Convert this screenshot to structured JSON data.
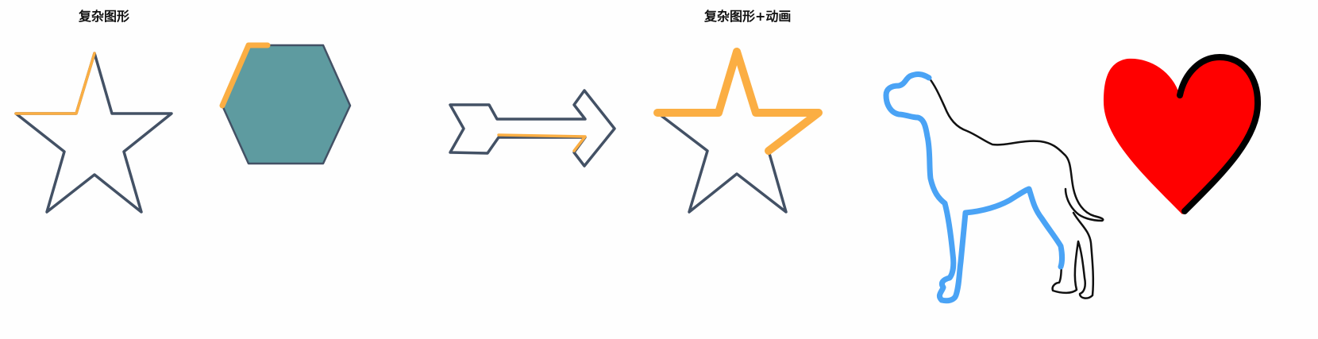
{
  "sections": [
    {
      "title": "复杂图形"
    },
    {
      "title": "复杂图形+动画"
    }
  ],
  "colors": {
    "outline": "#435165",
    "highlight": "#fbae43",
    "hexagon_fill": "#5e9ba0",
    "dog_trace": "#4aa3f5",
    "dog_outline": "#111111",
    "heart_fill": "#ff0000",
    "heart_outline": "#000000"
  },
  "shapes": [
    {
      "name": "star-outline",
      "icon": "star-icon"
    },
    {
      "name": "hexagon",
      "icon": "hexagon-icon"
    },
    {
      "name": "arrow-outline",
      "icon": "arrow-right-icon"
    },
    {
      "name": "star-animated",
      "icon": "star-icon"
    },
    {
      "name": "dog-silhouette",
      "icon": "dog-icon"
    },
    {
      "name": "heart",
      "icon": "heart-icon"
    }
  ]
}
